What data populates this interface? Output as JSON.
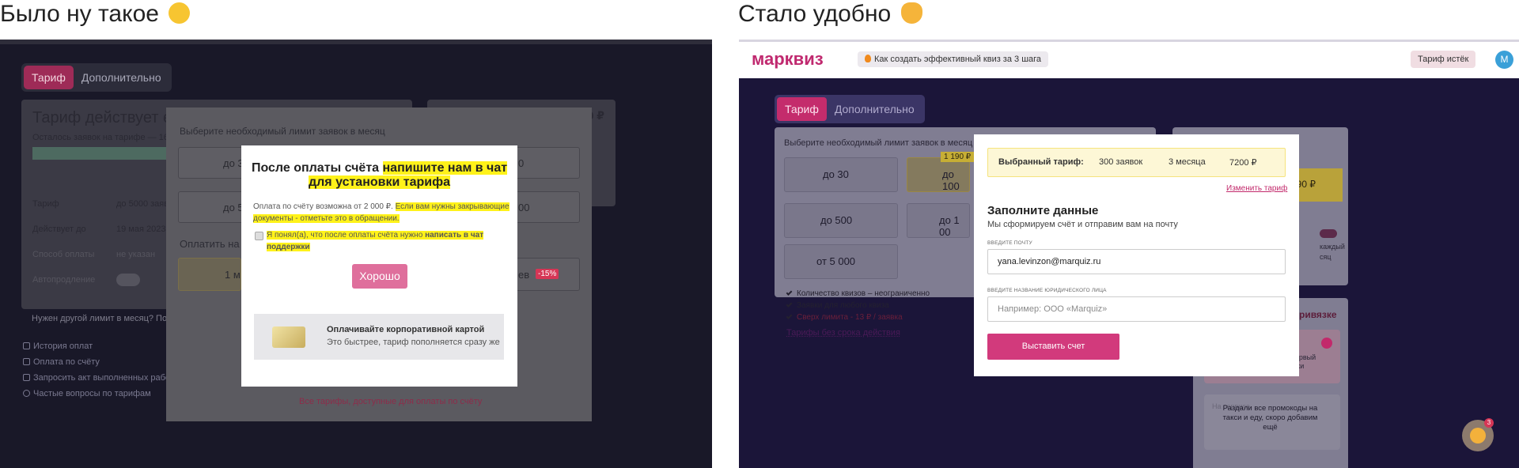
{
  "left": {
    "heading": "Было ну такое",
    "emoji": "rolling-eyes-emoji",
    "tabs": [
      "Тариф",
      "Дополнительно"
    ],
    "card_title": "Тариф действует еще",
    "card_remaining": "Осталось заявок на тарифе — 1649",
    "card_rows": [
      {
        "label": "Тариф",
        "value": "до 5000 заяв"
      },
      {
        "label": "Действует до",
        "value": "19 мая 2023"
      },
      {
        "label": "Способ оплаты",
        "value": "не указан"
      },
      {
        "label": "Автопродление",
        "value": ""
      }
    ],
    "price_fragment": "0 ₽",
    "other_limit": "Нужен другой лимит в месяц? Понем",
    "side_links": [
      "История оплат",
      "Оплата по счёту",
      "Запросить акт выполненных работ",
      "Частые вопросы по тарифам"
    ],
    "gray_modal": {
      "prompt": "Выберите необходимый лимит заявок в месяц",
      "boxes": [
        "до 3",
        "до 5",
        "0",
        "00"
      ],
      "pay_label": "Оплатить на пе",
      "month_label": "1 м",
      "term_label": "ев",
      "discount": "-15%",
      "all_link": "Все тарифы, доступные для оплаты по счёту"
    },
    "white_modal": {
      "title_plain": "После оплаты счёта ",
      "title_highlight_1": "напишите нам в чат",
      "title_highlight_2": "для установки тарифа",
      "note_plain": "Оплата по счёту возможна от 2 000 ₽. ",
      "note_highlight": "Если вам нужны закрывающие документы - отметьте это в обращении.",
      "check_plain": "Я понял(а), что после оплаты счёта нужно ",
      "check_bold": "написать в чат поддержки",
      "ok": "Хорошо",
      "card_title": "Оплачивайте корпоративной картой",
      "card_sub": "Это быстрее, тариф пополняется сразу же"
    }
  },
  "right": {
    "heading": "Стало удобно",
    "emoji": "heart-hands-emoji",
    "logo": "марквиз",
    "topbar_pill": "Как создать эффективный квиз за 3 шага",
    "tariff_expired": "Тариф истёк",
    "avatar": "M",
    "tabs": [
      "Тариф",
      "Дополнительно"
    ],
    "card_prompt": "Выберите необходимый лимит заявок в месяц",
    "boxes": [
      "до 30",
      "до 100",
      "до 500",
      "до 1 00",
      "от 5 000"
    ],
    "badge_price": "1 190 ₽",
    "side_price": "190 ₽",
    "features": [
      "Количество квизов – неограниченно",
      "Заявки для любого квиза",
      "Сверх лимита - 13 ₽ / заявка"
    ],
    "no_expiry_link": "Тарифы без срока действия",
    "side_toggle_text_1": "каждый",
    "side_toggle_text_2": "сяц",
    "promo_title": "ривязке",
    "promo_text": "Промокод на 5000 ₽ на первый запуск Рекламной подписки",
    "promo_text_2": "На сервисе",
    "tooltip": "Раздали все промокоды на такси и еду, скоро добавим ещё",
    "bubble_count": "3",
    "modal": {
      "sel_label": "Выбранный тариф:",
      "sel_requests": "300 заявок",
      "sel_term": "3 месяца",
      "sel_price": "7200 ₽",
      "change": "Изменить тариф",
      "title": "Заполните данные",
      "subtitle": "Мы сформируем счёт и отправим вам на почту",
      "email_label": "Введите почту",
      "email_value": "yana.levinzon@marquiz.ru",
      "company_label": "Введите название юридического лица",
      "company_placeholder": "Например: ООО «Marquiz»",
      "submit": "Выставить счет"
    }
  },
  "colors": {
    "brand": "#c0296f",
    "highlight": "#fff21a",
    "left_bg": "#191828",
    "right_bg": "#1b1539"
  }
}
